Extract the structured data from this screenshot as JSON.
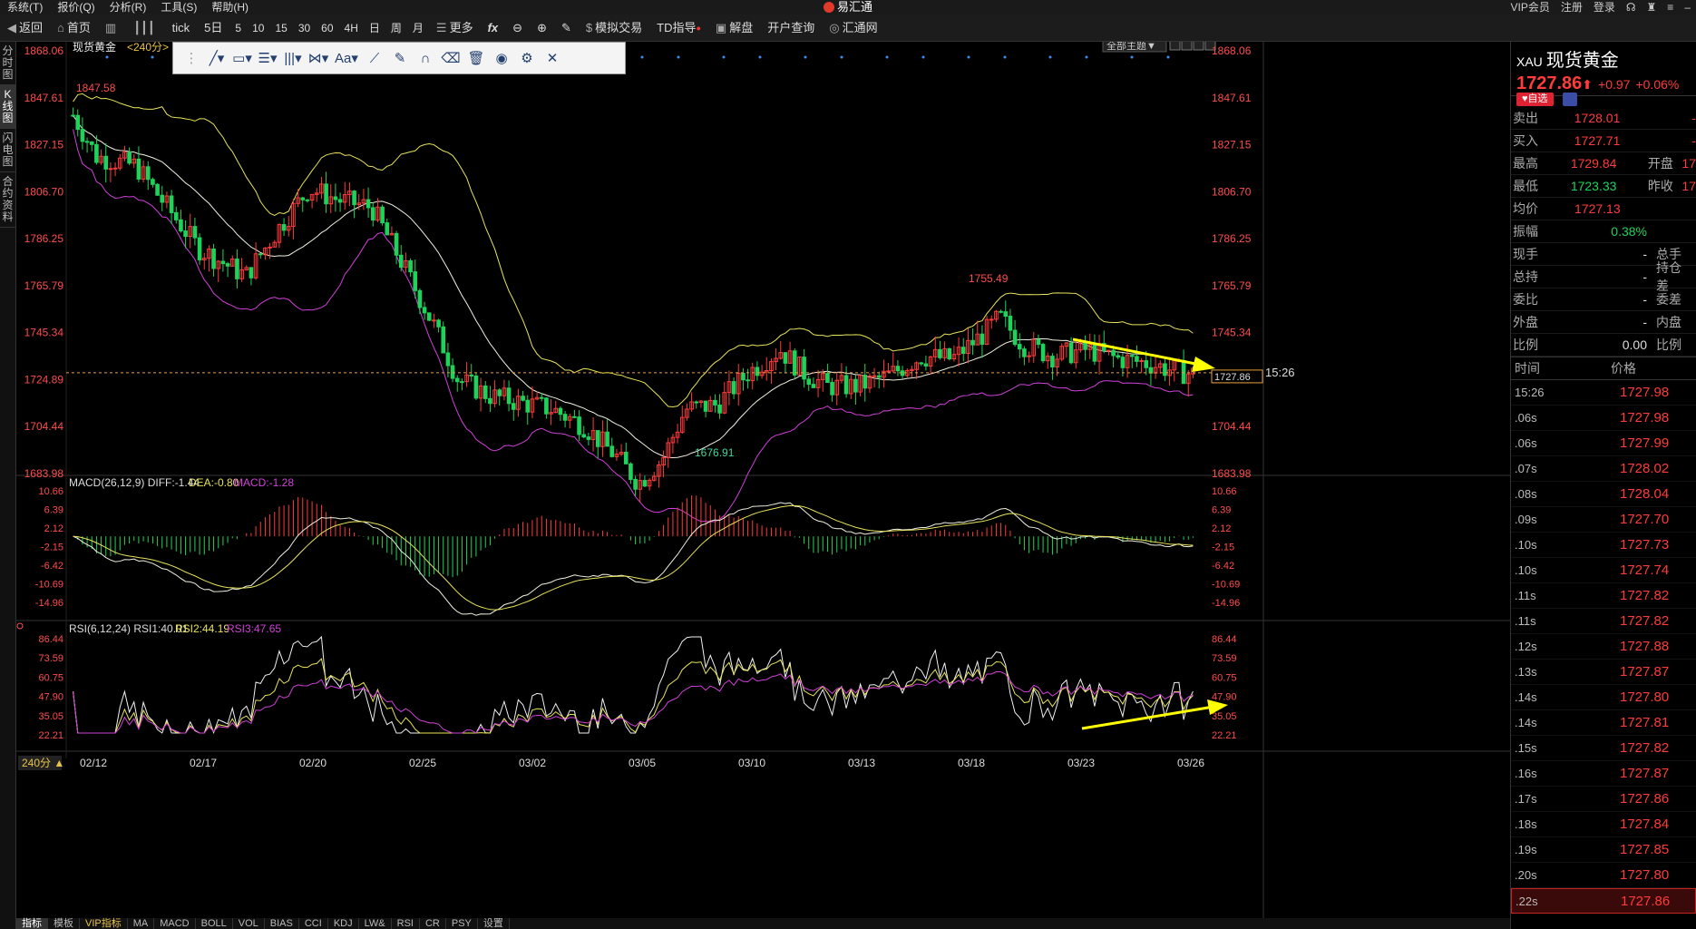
{
  "menubar": {
    "items": [
      "系统(T)",
      "报价(Q)",
      "分析(R)",
      "工具(S)",
      "帮助(H)"
    ],
    "app_title": "易汇通",
    "right_items": [
      "VIP会员",
      "注册",
      "登录"
    ]
  },
  "toolbar": {
    "items": [
      "返回",
      "首页",
      "tick",
      "5日",
      "5",
      "10",
      "15",
      "30",
      "60",
      "4H",
      "日",
      "周",
      "月",
      "更多",
      "fx",
      "模拟交易",
      "TD指导",
      "解盘",
      "开户查询",
      "汇通网"
    ]
  },
  "left_strip": [
    "分时图",
    "K线图",
    "闪电图",
    "合约资料"
  ],
  "chart_header": {
    "symbol": "现货黄金",
    "period": "<240分>",
    "theme_button": "全部主题▼"
  },
  "price_axis_labels": [
    "1868.06",
    "1847.61",
    "1827.15",
    "1806.70",
    "1786.25",
    "1765.79",
    "1745.34",
    "1724.89",
    "1704.44",
    "1683.98"
  ],
  "annotations": {
    "high": "1847.58",
    "swing_high": "1755.49",
    "low": "1676.91",
    "current_tag": "1727.86",
    "time_marker": "15:26"
  },
  "macd": {
    "title": "MACD(26,12,9)",
    "diff": "DIFF:-1.44",
    "dea": "DEA:-0.80",
    "macd": "MACD:-1.28",
    "axis": [
      "10.66",
      "6.39",
      "2.12",
      "-2.15",
      "-6.42",
      "-10.69",
      "-14.96"
    ]
  },
  "rsi": {
    "title": "RSI(6,12,24)",
    "rsi1": "RSI1:40.01",
    "rsi2": "RSI2:44.19",
    "rsi3": "RSI3:47.65",
    "axis": [
      "86.44",
      "73.59",
      "60.75",
      "47.90",
      "35.05",
      "22.21"
    ]
  },
  "date_axis": [
    "02/12",
    "02/17",
    "02/20",
    "02/25",
    "03/02",
    "03/05",
    "03/10",
    "03/13",
    "03/18",
    "03/23",
    "03/26"
  ],
  "period_button": "240分",
  "bottom_tabs": [
    "指标",
    "模板",
    "VIP指标",
    "MA",
    "MACD",
    "BOLL",
    "VOL",
    "BIAS",
    "CCI",
    "KDJ",
    "LW&",
    "RSI",
    "CR",
    "PSY",
    "设置"
  ],
  "colors": {
    "up": "#ff3b3b",
    "down": "#1ed35b",
    "boll_up": "#e8e35a",
    "boll_mid": "#f0f0e0",
    "boll_low": "#d040d8",
    "arrow": "#ffff00"
  },
  "quote": {
    "code": "XAU",
    "name": "现货黄金",
    "price": "1727.86",
    "arrow": "⬆",
    "change": "+0.97",
    "change_pct": "+0.06%",
    "fav_button": "自选",
    "rows": [
      {
        "k": "卖出",
        "v": "1728.01",
        "k2": "",
        "v2": "-"
      },
      {
        "k": "买入",
        "v": "1727.71",
        "k2": "",
        "v2": "-"
      },
      {
        "k": "最高",
        "v": "1729.84",
        "k2": "开盘",
        "v2": "17"
      },
      {
        "k": "最低",
        "v": "1723.33",
        "k2": "昨收",
        "v2": "17"
      },
      {
        "k": "均价",
        "v": "1727.13",
        "k2": "",
        "v2": ""
      },
      {
        "k": "振幅",
        "v": "0.38%",
        "k2": "",
        "v2": ""
      },
      {
        "k": "现手",
        "v": "-",
        "k2": "总手",
        "v2": ""
      },
      {
        "k": "总持",
        "v": "-",
        "k2": "持仓差",
        "v2": ""
      },
      {
        "k": "委比",
        "v": "-",
        "k2": "委差",
        "v2": ""
      },
      {
        "k": "外盘",
        "v": "-",
        "k2": "内盘",
        "v2": ""
      },
      {
        "k": "比例",
        "v": "0.00",
        "k2": "比例",
        "v2": ""
      }
    ],
    "ticks_header": {
      "time": "时间",
      "price": "价格"
    },
    "ticks": [
      {
        "t": "15:26",
        "p": "1727.98"
      },
      {
        "t": ".06s",
        "p": "1727.98"
      },
      {
        "t": ".06s",
        "p": "1727.99"
      },
      {
        "t": ".07s",
        "p": "1728.02"
      },
      {
        "t": ".08s",
        "p": "1728.04"
      },
      {
        "t": ".09s",
        "p": "1727.70"
      },
      {
        "t": ".10s",
        "p": "1727.73"
      },
      {
        "t": ".10s",
        "p": "1727.74"
      },
      {
        "t": ".11s",
        "p": "1727.82"
      },
      {
        "t": ".11s",
        "p": "1727.82"
      },
      {
        "t": ".12s",
        "p": "1727.88"
      },
      {
        "t": ".13s",
        "p": "1727.87"
      },
      {
        "t": ".14s",
        "p": "1727.80"
      },
      {
        "t": ".14s",
        "p": "1727.81"
      },
      {
        "t": ".15s",
        "p": "1727.82"
      },
      {
        "t": ".16s",
        "p": "1727.87"
      },
      {
        "t": ".17s",
        "p": "1727.86"
      },
      {
        "t": ".18s",
        "p": "1727.84"
      },
      {
        "t": ".19s",
        "p": "1727.85"
      },
      {
        "t": ".20s",
        "p": "1727.80"
      },
      {
        "t": ".22s",
        "p": "1727.86"
      }
    ]
  }
}
